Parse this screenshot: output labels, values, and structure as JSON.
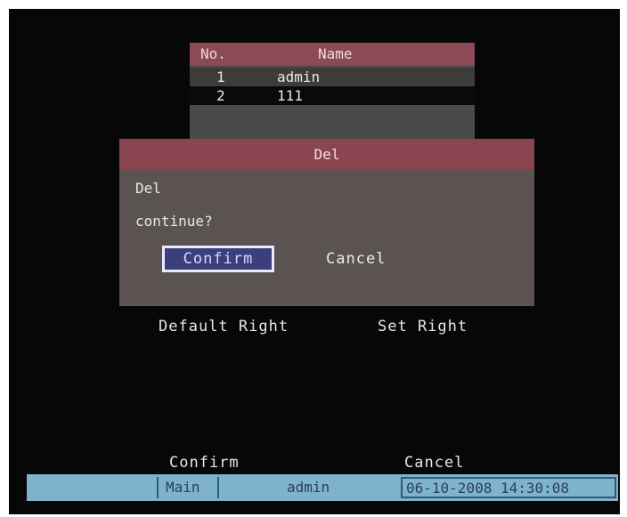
{
  "table": {
    "headers": [
      "No.",
      "Name"
    ],
    "rows": [
      {
        "no": "1",
        "name": "admin"
      },
      {
        "no": "2",
        "name": "111"
      }
    ]
  },
  "dialog": {
    "title": "Del",
    "line1": "Del",
    "line2": "continue?",
    "confirm_label": "Confirm",
    "cancel_label": "Cancel"
  },
  "rights": {
    "default_label": "Default Right",
    "set_label": "Set Right"
  },
  "footer_buttons": {
    "confirm_label": "Confirm",
    "cancel_label": "Cancel"
  },
  "statusbar": {
    "menu": "Main",
    "user": "admin",
    "datetime": "06-10-2008 14:30:08"
  }
}
